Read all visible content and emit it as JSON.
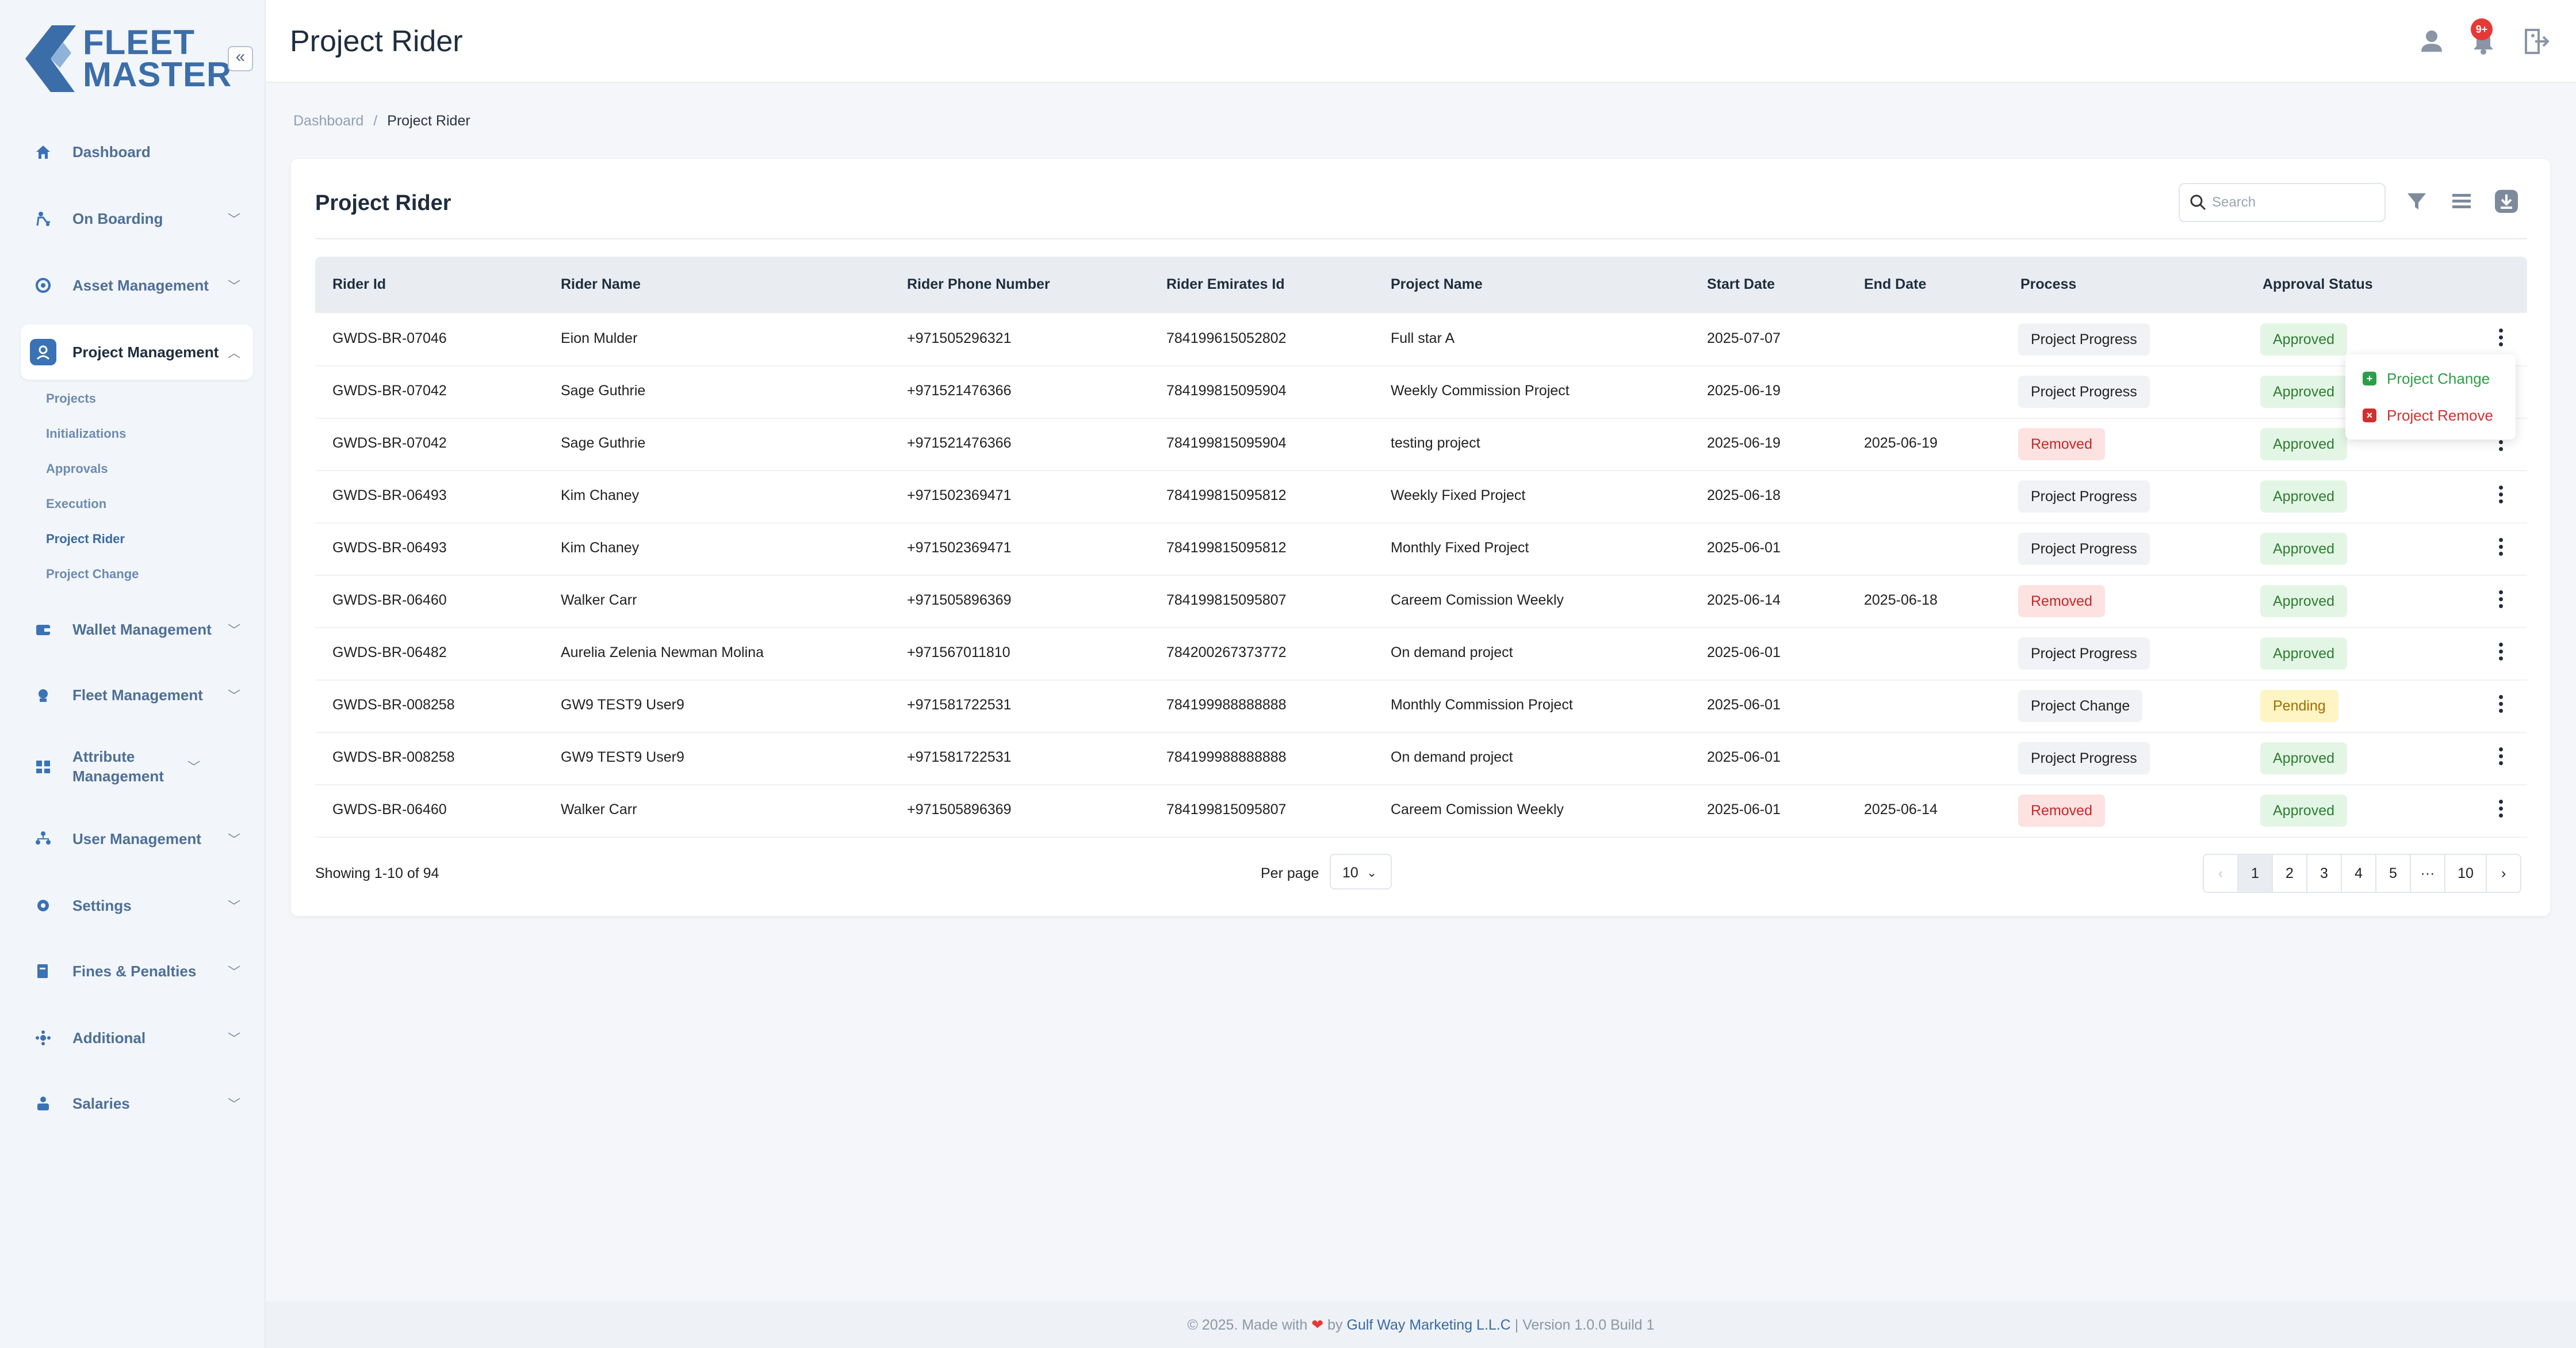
{
  "brand": {
    "line1": "FLEET",
    "line2": "MASTER"
  },
  "sidebar": {
    "collapse_glyph": "«",
    "items": [
      {
        "label": "Dashboard",
        "icon": "home-icon",
        "has_chevron": false
      },
      {
        "label": "On Boarding",
        "icon": "rider-icon",
        "has_chevron": true
      },
      {
        "label": "Asset Management",
        "icon": "asset-icon",
        "has_chevron": true
      },
      {
        "label": "Project Management",
        "icon": "project-icon",
        "has_chevron": true,
        "active": true
      },
      {
        "label": "Wallet Management",
        "icon": "wallet-icon",
        "has_chevron": true
      },
      {
        "label": "Fleet Management",
        "icon": "fleet-icon",
        "has_chevron": true
      },
      {
        "label": "Attribute Management",
        "icon": "attribute-icon",
        "has_chevron": true
      },
      {
        "label": "User Management",
        "icon": "users-icon",
        "has_chevron": true
      },
      {
        "label": "Settings",
        "icon": "gear-icon",
        "has_chevron": true
      },
      {
        "label": "Fines & Penalties",
        "icon": "fines-icon",
        "has_chevron": true
      },
      {
        "label": "Additional",
        "icon": "additional-icon",
        "has_chevron": true
      },
      {
        "label": "Salaries",
        "icon": "salaries-icon",
        "has_chevron": true
      }
    ],
    "sub_items": [
      {
        "label": "Projects"
      },
      {
        "label": "Initializations"
      },
      {
        "label": "Approvals"
      },
      {
        "label": "Execution"
      },
      {
        "label": "Project Rider",
        "active": true
      },
      {
        "label": "Project Change"
      }
    ]
  },
  "header": {
    "title": "Project Rider",
    "notification_count": "9+"
  },
  "breadcrumb": {
    "root": "Dashboard",
    "separator": "/",
    "current": "Project Rider"
  },
  "card": {
    "title": "Project Rider",
    "search_placeholder": "Search"
  },
  "table": {
    "columns": [
      "Rider Id",
      "Rider Name",
      "Rider Phone Number",
      "Rider Emirates Id",
      "Project Name",
      "Start Date",
      "End Date",
      "Process",
      "Approval Status"
    ],
    "rows": [
      {
        "id": "GWDS-BR-07046",
        "name": "Eion Mulder",
        "phone": "+971505296321",
        "emirates": "784199615052802",
        "project": "Full star A",
        "start": "2025-07-07",
        "end": "",
        "process": "Project Progress",
        "status": "Approved"
      },
      {
        "id": "GWDS-BR-07042",
        "name": "Sage Guthrie",
        "phone": "+971521476366",
        "emirates": "784199815095904",
        "project": "Weekly Commission Project",
        "start": "2025-06-19",
        "end": "",
        "process": "Project Progress",
        "status": "Approved"
      },
      {
        "id": "GWDS-BR-07042",
        "name": "Sage Guthrie",
        "phone": "+971521476366",
        "emirates": "784199815095904",
        "project": "testing project",
        "start": "2025-06-19",
        "end": "2025-06-19",
        "process": "Removed",
        "status": "Approved"
      },
      {
        "id": "GWDS-BR-06493",
        "name": "Kim Chaney",
        "phone": "+971502369471",
        "emirates": "784199815095812",
        "project": "Weekly Fixed Project",
        "start": "2025-06-18",
        "end": "",
        "process": "Project Progress",
        "status": "Approved"
      },
      {
        "id": "GWDS-BR-06493",
        "name": "Kim Chaney",
        "phone": "+971502369471",
        "emirates": "784199815095812",
        "project": "Monthly Fixed Project",
        "start": "2025-06-01",
        "end": "",
        "process": "Project Progress",
        "status": "Approved"
      },
      {
        "id": "GWDS-BR-06460",
        "name": "Walker Carr",
        "phone": "+971505896369",
        "emirates": "784199815095807",
        "project": "Careem Comission Weekly",
        "start": "2025-06-14",
        "end": "2025-06-18",
        "process": "Removed",
        "status": "Approved"
      },
      {
        "id": "GWDS-BR-06482",
        "name": "Aurelia Zelenia Newman Molina",
        "phone": "+971567011810",
        "emirates": "784200267373772",
        "project": "On demand project",
        "start": "2025-06-01",
        "end": "",
        "process": "Project Progress",
        "status": "Approved"
      },
      {
        "id": "GWDS-BR-008258",
        "name": "GW9 TEST9 User9",
        "phone": "+971581722531",
        "emirates": "784199988888888",
        "project": "Monthly Commission Project",
        "start": "2025-06-01",
        "end": "",
        "process": "Project Change",
        "status": "Pending"
      },
      {
        "id": "GWDS-BR-008258",
        "name": "GW9 TEST9 User9",
        "phone": "+971581722531",
        "emirates": "784199988888888",
        "project": "On demand project",
        "start": "2025-06-01",
        "end": "",
        "process": "Project Progress",
        "status": "Approved"
      },
      {
        "id": "GWDS-BR-06460",
        "name": "Walker Carr",
        "phone": "+971505896369",
        "emirates": "784199815095807",
        "project": "Careem Comission Weekly",
        "start": "2025-06-01",
        "end": "2025-06-14",
        "process": "Removed",
        "status": "Approved"
      }
    ]
  },
  "row_menu": {
    "change_label": "Project Change",
    "remove_label": "Project Remove"
  },
  "pagination": {
    "showing": "Showing 1-10 of 94",
    "per_page_label": "Per page",
    "per_page_value": "10",
    "prev": "‹",
    "pages": [
      "1",
      "2",
      "3",
      "4",
      "5",
      "···",
      "10"
    ],
    "current": "1",
    "next": "›"
  },
  "footer": {
    "prefix": "© 2025. Made with",
    "heart": "❤",
    "by": "by",
    "company": "Gulf Way Marketing L.L.C",
    "version": "| Version 1.0.0 Build 1"
  },
  "colors": {
    "accent": "#3a72b5",
    "approved": "#2e7d32",
    "removed": "#c62828",
    "pending": "#a06d00"
  }
}
